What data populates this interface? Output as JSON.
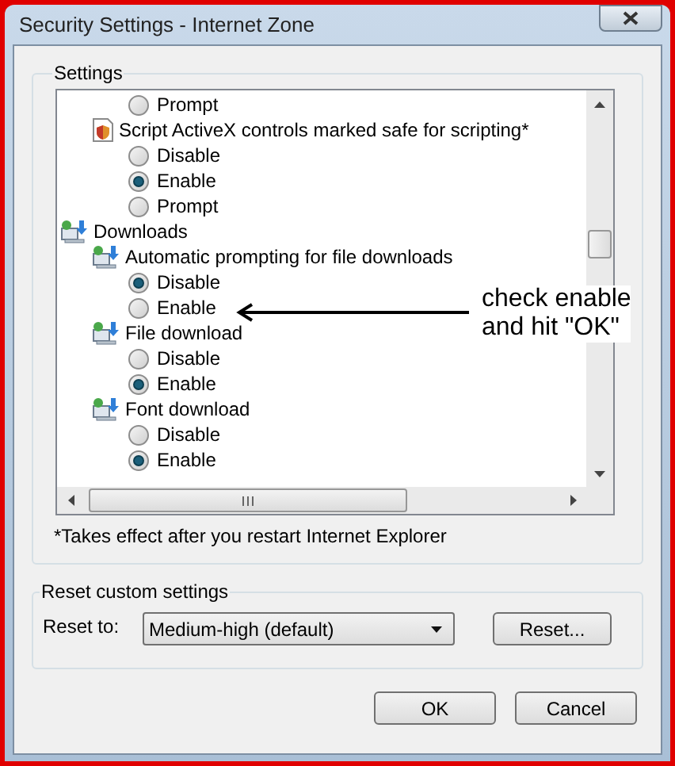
{
  "window": {
    "title": "Security Settings - Internet Zone"
  },
  "settings_group": {
    "label": "Settings",
    "items": [
      {
        "kind": "option",
        "label": "Prompt",
        "selected": false
      },
      {
        "kind": "script_setting",
        "label": "Script ActiveX controls marked safe for scripting*",
        "children": [
          {
            "kind": "option",
            "label": "Disable",
            "selected": false
          },
          {
            "kind": "option",
            "label": "Enable",
            "selected": true
          },
          {
            "kind": "option",
            "label": "Prompt",
            "selected": false
          }
        ]
      },
      {
        "kind": "category",
        "label": "Downloads",
        "children": [
          {
            "kind": "setting",
            "label": "Automatic prompting for file downloads",
            "children": [
              {
                "kind": "option",
                "label": "Disable",
                "selected": true
              },
              {
                "kind": "option",
                "label": "Enable",
                "selected": false
              }
            ]
          },
          {
            "kind": "setting",
            "label": "File download",
            "children": [
              {
                "kind": "option",
                "label": "Disable",
                "selected": false
              },
              {
                "kind": "option",
                "label": "Enable",
                "selected": true
              }
            ]
          },
          {
            "kind": "setting",
            "label": "Font download",
            "children": [
              {
                "kind": "option",
                "label": "Disable",
                "selected": false
              },
              {
                "kind": "option",
                "label": "Enable",
                "selected": true
              }
            ]
          }
        ]
      }
    ],
    "footnote": "*Takes effect after you restart Internet Explorer"
  },
  "annotation": {
    "lines": [
      "check enable",
      "and hit \"OK\""
    ]
  },
  "reset_group": {
    "label": "Reset custom settings",
    "field_label": "Reset to:",
    "dropdown_value": "Medium-high (default)",
    "button": "Reset..."
  },
  "buttons": [
    "OK",
    "Cancel"
  ]
}
